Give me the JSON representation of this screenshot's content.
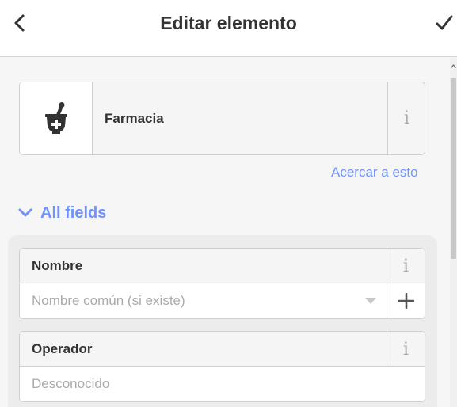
{
  "header": {
    "title": "Editar elemento",
    "back_icon": "chevron-left-icon",
    "save_icon": "checkmark-icon"
  },
  "preset": {
    "label": "Farmacia",
    "icon": "pharmacy-icon",
    "info_glyph": "i"
  },
  "zoom_link": "Acercar a esto",
  "all_fields": {
    "label": "All fields",
    "icon": "chevron-down-icon",
    "expanded": true
  },
  "fields": [
    {
      "label": "Nombre",
      "info_glyph": "i",
      "value": "",
      "placeholder": "Nombre común (si existe)",
      "has_dropdown": true,
      "has_add_button": true
    },
    {
      "label": "Operador",
      "info_glyph": "i",
      "value": "",
      "placeholder": "Desconocido",
      "has_dropdown": false,
      "has_add_button": false
    }
  ],
  "colors": {
    "accent": "#7092ff",
    "text": "#333333",
    "muted": "#aaaaaa",
    "border": "#cfcfcf",
    "background": "#f6f6f6"
  }
}
